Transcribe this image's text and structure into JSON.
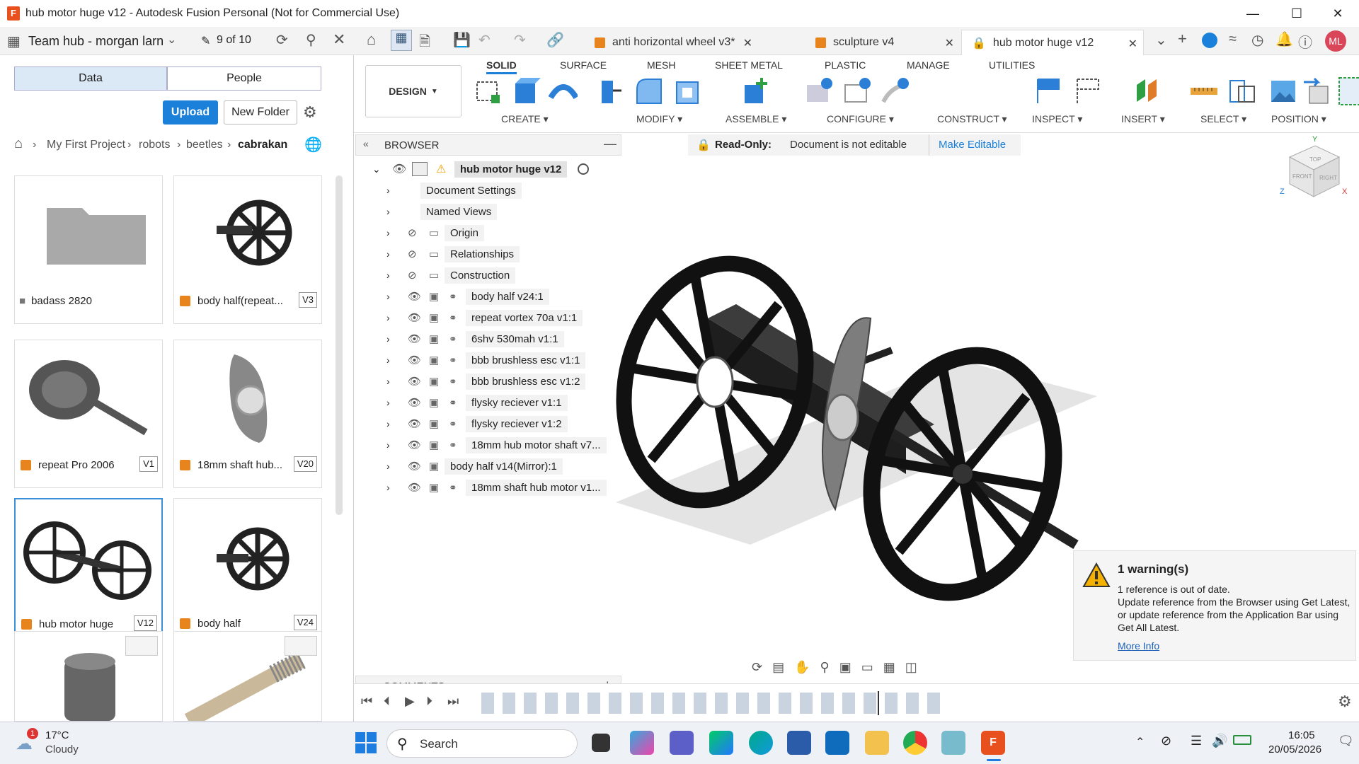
{
  "window": {
    "title": "hub motor huge v12 - Autodesk Fusion Personal (Not for Commercial Use)",
    "app_letter": "F"
  },
  "appbar": {
    "team": "Team hub - morgan larn",
    "job_count": "9 of 10",
    "tabs": [
      {
        "label": "anti horizontal wheel v3*"
      },
      {
        "label": "sculpture v4"
      },
      {
        "label": "hub motor huge v12"
      }
    ],
    "avatar": "ML"
  },
  "data_panel": {
    "seg_data": "Data",
    "seg_people": "People",
    "upload": "Upload",
    "new_folder": "New Folder",
    "breadcrumb": [
      "My First Project",
      "robots",
      "beetles",
      "cabrakan"
    ],
    "cards": [
      {
        "name": "badass 2820",
        "version": ""
      },
      {
        "name": "body half(repeat...",
        "version": "V3"
      },
      {
        "name": "repeat Pro 2006",
        "version": "V1"
      },
      {
        "name": "18mm shaft hub...",
        "version": "V20"
      },
      {
        "name": "hub motor huge",
        "version": "V12"
      },
      {
        "name": "body half",
        "version": "V24"
      }
    ]
  },
  "toolbar": {
    "design": "DESIGN",
    "tabs": [
      "SOLID",
      "SURFACE",
      "MESH",
      "SHEET METAL",
      "PLASTIC",
      "MANAGE",
      "UTILITIES"
    ],
    "groups": [
      "CREATE",
      "MODIFY",
      "ASSEMBLE",
      "CONFIGURE",
      "CONSTRUCT",
      "INSPECT",
      "INSERT",
      "SELECT",
      "POSITION"
    ]
  },
  "browser": {
    "header": "BROWSER",
    "root": "hub motor huge v12",
    "items": [
      "Document Settings",
      "Named Views",
      "Origin",
      "Relationships",
      "Construction",
      "body half v24:1",
      "repeat vortex 70a v1:1",
      "6shv 530mah v1:1",
      "bbb brushless esc v1:1",
      "bbb brushless esc v1:2",
      "flysky reciever v1:1",
      "flysky reciever v1:2",
      "18mm hub motor shaft v7...",
      "body half v14(Mirror):1",
      "18mm shaft hub motor v1..."
    ],
    "comments": "COMMENTS"
  },
  "readonly": {
    "label": "Read-Only:",
    "message": "Document is not editable",
    "action": "Make Editable"
  },
  "warning": {
    "title": "1 warning(s)",
    "line1": "1 reference is out of date.",
    "line2": "Update reference from the Browser using Get Latest,",
    "line3": "or update reference from the Application Bar using",
    "line4": "Get All Latest.",
    "link": "More Info"
  },
  "viewcube": {
    "top": "TOP",
    "front": "FRONT",
    "right": "RIGHT",
    "x": "X",
    "y": "Y",
    "z": "Z"
  },
  "taskbar": {
    "weather_temp": "17°C",
    "weather_desc": "Cloudy",
    "weather_badge": "1",
    "search": "Search",
    "time": "16:05",
    "date": "20/05/2026"
  },
  "colors": {
    "accent": "#1b80d9",
    "warning": "#f5b100",
    "part": "#e8841e"
  }
}
